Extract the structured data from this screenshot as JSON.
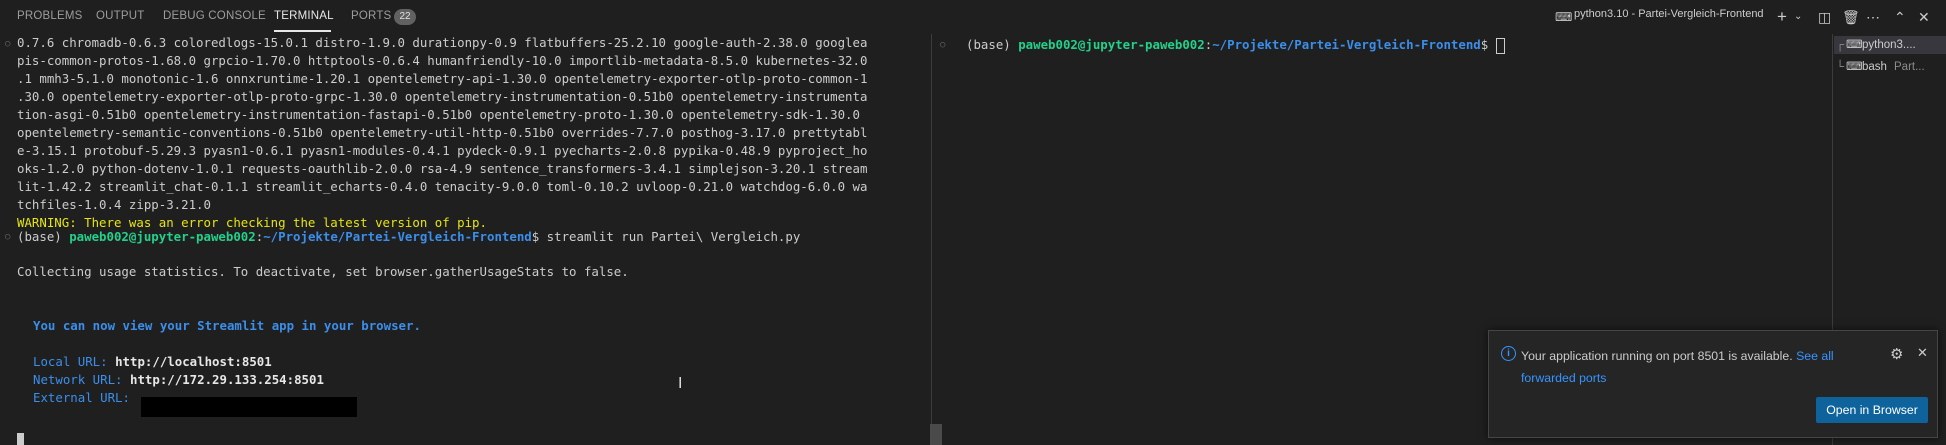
{
  "panel": {
    "tabs": [
      {
        "label": "PROBLEMS"
      },
      {
        "label": "OUTPUT"
      },
      {
        "label": "DEBUG CONSOLE"
      },
      {
        "label": "TERMINAL"
      },
      {
        "label": "PORTS"
      }
    ],
    "ports_count": "22",
    "terminal_title": "python3.10 - Partei-Vergleich-Frontend",
    "icons": {
      "add": "plus-icon",
      "dropdown": "chevron-down-icon",
      "split": "split-icon",
      "trash": "trash-icon",
      "more": "ellipsis-icon",
      "maximize": "chevron-up-icon",
      "close": "close-icon"
    }
  },
  "terminal_left": {
    "lines": [
      "0.7.6 chromadb-0.6.3 coloredlogs-15.0.1 distro-1.9.0 durationpy-0.9 flatbuffers-25.2.10 google-auth-2.38.0 googlea",
      "pis-common-protos-1.68.0 grpcio-1.70.0 httptools-0.6.4 humanfriendly-10.0 importlib-metadata-8.5.0 kubernetes-32.0",
      ".1 mmh3-5.1.0 monotonic-1.6 onnxruntime-1.20.1 opentelemetry-api-1.30.0 opentelemetry-exporter-otlp-proto-common-1",
      ".30.0 opentelemetry-exporter-otlp-proto-grpc-1.30.0 opentelemetry-instrumentation-0.51b0 opentelemetry-instrumenta",
      "tion-asgi-0.51b0 opentelemetry-instrumentation-fastapi-0.51b0 opentelemetry-proto-1.30.0 opentelemetry-sdk-1.30.0",
      "opentelemetry-semantic-conventions-0.51b0 opentelemetry-util-http-0.51b0 overrides-7.7.0 posthog-3.17.0 prettytabl",
      "e-3.15.1 protobuf-5.29.3 pyasn1-0.6.1 pyasn1-modules-0.4.1 pydeck-0.9.1 pyecharts-2.0.8 pypika-0.48.9 pyproject_ho",
      "oks-1.2.0 python-dotenv-1.0.1 requests-oauthlib-2.0.0 rsa-4.9 sentence_transformers-3.4.1 simplejson-3.20.1 stream",
      "lit-1.42.2 streamlit_chat-0.1.1 streamlit_echarts-0.4.0 tenacity-9.0.0 toml-0.10.2 uvloop-0.21.0 watchdog-6.0.0 wa",
      "tchfiles-1.0.4 zipp-3.21.0"
    ],
    "warning": "WARNING: There was an error checking the latest version of pip.",
    "prompt_env": "(base) ",
    "prompt_user": "paweb002@jupyter-paweb002",
    "prompt_colon": ":",
    "prompt_path": "~/Projekte/Partei-Vergleich-Frontend",
    "prompt_dollar": "$ ",
    "command": "streamlit run Partei\\ Vergleich.py",
    "collecting": "Collecting usage statistics. To deactivate, set browser.gatherUsageStats to false.",
    "view_msg": "You can now view your Streamlit app in your browser.",
    "local_label": "Local URL: ",
    "local_url": "http://localhost:8501",
    "network_label": "Network URL: ",
    "network_url": "http://172.29.133.254:8501",
    "external_label": "External URL: "
  },
  "terminal_right": {
    "prompt_env": "(base) ",
    "prompt_user": "paweb002@jupyter-paweb002",
    "prompt_colon": ":",
    "prompt_path": "~/Projekte/Partei-Vergleich-Frontend",
    "prompt_dollar": "$ "
  },
  "terminal_list": {
    "items": [
      {
        "label": "python3....",
        "icon": "terminal-icon"
      },
      {
        "label": "bash",
        "sub": "Part...",
        "icon": "terminal-icon"
      }
    ]
  },
  "notification": {
    "message": "Your application running on port 8501 is available.",
    "link": "See all forwarded ports",
    "button": "Open in Browser",
    "icons": {
      "info": "info-icon",
      "settings": "gear-icon",
      "close": "close-icon"
    }
  }
}
